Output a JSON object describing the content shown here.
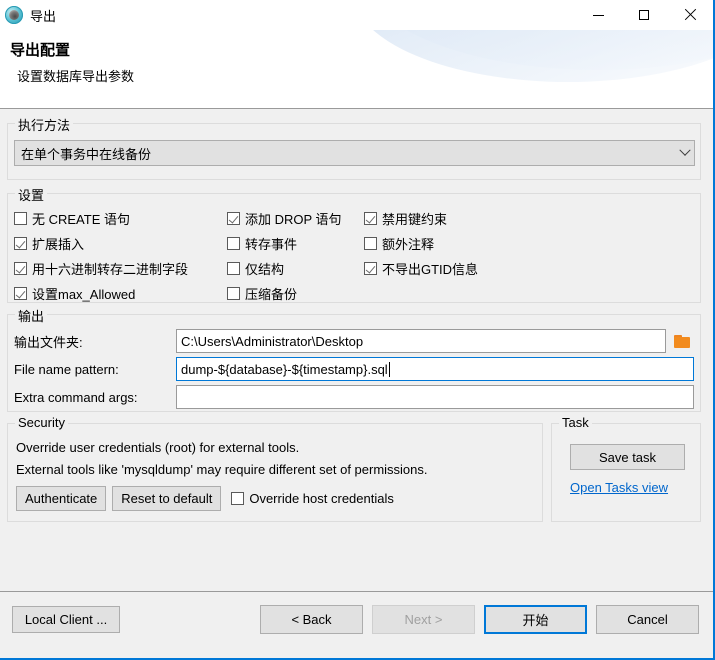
{
  "window": {
    "title": "导出",
    "app_icon": "database-app-icon",
    "caption": {
      "minimize": "minimize-icon",
      "maximize": "maximize-icon",
      "close": "close-icon"
    },
    "active_border_color": "#0078d7"
  },
  "header": {
    "title": "导出配置",
    "subtitle": "设置数据库导出参数"
  },
  "exec_method": {
    "group_title": "执行方法",
    "selected": "在单个事务中在线备份",
    "chevron": "chevron-down-icon"
  },
  "settings": {
    "group_title": "设置",
    "rows": [
      [
        {
          "label": "无 CREATE 语句",
          "checked": false
        },
        {
          "label": "添加 DROP 语句",
          "checked": true
        },
        {
          "label": "禁用键约束",
          "checked": true
        }
      ],
      [
        {
          "label": "扩展插入",
          "checked": true
        },
        {
          "label": "转存事件",
          "checked": false
        },
        {
          "label": "额外注释",
          "checked": false
        }
      ],
      [
        {
          "label": "用十六进制转存二进制字段",
          "checked": true
        },
        {
          "label": "仅结构",
          "checked": false
        },
        {
          "label": "不导出GTID信息",
          "checked": true
        }
      ],
      [
        {
          "label": "设置max_Allowed",
          "checked": true
        },
        {
          "label": "压缩备份",
          "checked": false
        },
        {
          "label": "",
          "checked": false
        }
      ]
    ]
  },
  "output": {
    "group_title": "输出",
    "folder": {
      "label": "输出文件夹:",
      "value": "C:\\Users\\Administrator\\Desktop",
      "browse_icon": "folder-icon"
    },
    "pattern": {
      "label": "File name pattern:",
      "value": "dump-${database}-${timestamp}.sql",
      "focused": true
    },
    "extra_args": {
      "label": "Extra command args:",
      "value": ""
    }
  },
  "security": {
    "group_title": "Security",
    "line1": "Override user credentials (root) for external tools.",
    "line2": "External tools like 'mysqldump' may require different set of permissions.",
    "authenticate_label": "Authenticate",
    "reset_label": "Reset to default",
    "override_checkbox": {
      "label": "Override host credentials",
      "checked": false
    }
  },
  "task": {
    "group_title": "Task",
    "save_label": "Save task",
    "open_view_label": "Open Tasks view",
    "link_color": "#0066cc"
  },
  "bottom": {
    "local_client_label": "Local Client ...",
    "back_label": "< Back",
    "next_label": "Next >",
    "next_disabled": true,
    "start_label": "开始",
    "cancel_label": "Cancel"
  }
}
